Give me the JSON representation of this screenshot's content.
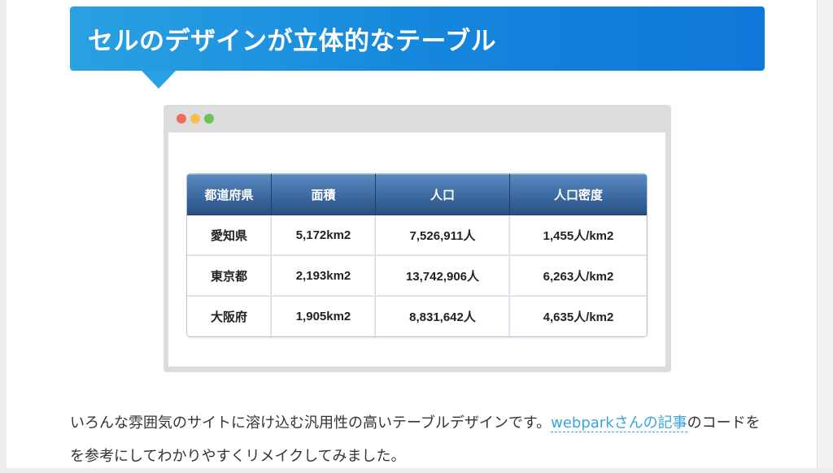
{
  "heading": {
    "title": "セルのデザインが立体的なテーブル"
  },
  "browser_mock": {
    "table": {
      "headers": [
        "都道府県",
        "面積",
        "人口",
        "人口密度"
      ],
      "rows": [
        [
          "愛知県",
          "5,172km2",
          "7,526,911人",
          "1,455人/km2"
        ],
        [
          "東京都",
          "2,193km2",
          "13,742,906人",
          "6,263人/km2"
        ],
        [
          "大阪府",
          "1,905km2",
          "8,831,642人",
          "4,635人/km2"
        ]
      ]
    }
  },
  "paragraph": {
    "before_link": "いろんな雰囲気のサイトに溶け込む汎用性の高いテーブルデザインです。",
    "link_text": "webparkさんの記事",
    "after_link": "のコードをを参考にしてわかりやすくリメイクしてみました。"
  },
  "colors": {
    "heading_gradient_start": "#2aa1e2",
    "heading_gradient_end": "#0f78da",
    "table_header": "#3c6aa2",
    "link": "#3aa3de"
  }
}
